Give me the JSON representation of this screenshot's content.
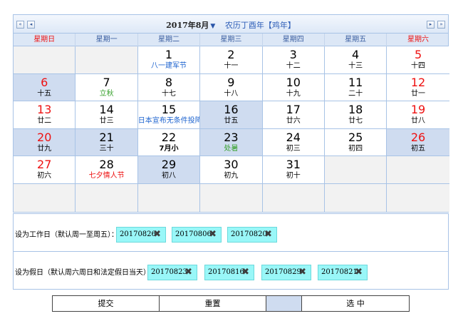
{
  "calendar": {
    "month_title": "2017年8月",
    "caret": "▼",
    "lunar_year": "农历丁酉年【鸡年】",
    "nav": {
      "prev_year": "«",
      "prev_month": "◂",
      "next_month": "▸",
      "next_year": "»"
    },
    "weekdays": [
      "星期日",
      "星期一",
      "星期二",
      "星期三",
      "星期四",
      "星期五",
      "星期六"
    ],
    "days": [
      {
        "num": "",
        "lunar": ""
      },
      {
        "num": "",
        "lunar": ""
      },
      {
        "num": "1",
        "lunar": "八一建军节",
        "cls": "holiday-blue"
      },
      {
        "num": "2",
        "lunar": "十一"
      },
      {
        "num": "3",
        "lunar": "十二"
      },
      {
        "num": "4",
        "lunar": "十三"
      },
      {
        "num": "5",
        "lunar": "十四"
      },
      {
        "num": "6",
        "lunar": "十五",
        "selected": true
      },
      {
        "num": "7",
        "lunar": "立秋",
        "cls": "holiday-green"
      },
      {
        "num": "8",
        "lunar": "十七"
      },
      {
        "num": "9",
        "lunar": "十八"
      },
      {
        "num": "10",
        "lunar": "十九"
      },
      {
        "num": "11",
        "lunar": "二十"
      },
      {
        "num": "12",
        "lunar": "廿一"
      },
      {
        "num": "13",
        "lunar": "廿二"
      },
      {
        "num": "14",
        "lunar": "廿三"
      },
      {
        "num": "15",
        "lunar": "日本宣布无条件投降",
        "cls": "holiday-blue"
      },
      {
        "num": "16",
        "lunar": "廿五",
        "selected": true
      },
      {
        "num": "17",
        "lunar": "廿六"
      },
      {
        "num": "18",
        "lunar": "廿七"
      },
      {
        "num": "19",
        "lunar": "廿八"
      },
      {
        "num": "20",
        "lunar": "廿九",
        "selected": true
      },
      {
        "num": "21",
        "lunar": "三十",
        "selected": true
      },
      {
        "num": "22",
        "lunar": "7月小",
        "cls": "bold"
      },
      {
        "num": "23",
        "lunar": "处暑",
        "cls": "holiday-green",
        "selected": true
      },
      {
        "num": "24",
        "lunar": "初三"
      },
      {
        "num": "25",
        "lunar": "初四"
      },
      {
        "num": "26",
        "lunar": "初五",
        "selected": true
      },
      {
        "num": "27",
        "lunar": "初六"
      },
      {
        "num": "28",
        "lunar": "七夕情人节",
        "cls": "holiday-red"
      },
      {
        "num": "29",
        "lunar": "初八",
        "selected": true
      },
      {
        "num": "30",
        "lunar": "初九"
      },
      {
        "num": "31",
        "lunar": "初十"
      },
      {
        "num": "",
        "lunar": ""
      },
      {
        "num": "",
        "lunar": ""
      },
      {
        "num": "",
        "lunar": ""
      },
      {
        "num": "",
        "lunar": ""
      },
      {
        "num": "",
        "lunar": ""
      },
      {
        "num": "",
        "lunar": ""
      },
      {
        "num": "",
        "lunar": ""
      },
      {
        "num": "",
        "lunar": ""
      },
      {
        "num": "",
        "lunar": ""
      }
    ]
  },
  "settings": {
    "workday_label": "设为工作日（默认周一至周五）：",
    "workday_tags": [
      "20170826",
      "20170806",
      "20170820"
    ],
    "holiday_label": "设为假日（默认周六周日和法定假日当天）：",
    "holiday_tags": [
      "20170823",
      "20170816",
      "20170829",
      "20170821"
    ],
    "remove_glyph": "✖"
  },
  "actions": {
    "submit": "提交",
    "reset": "重置",
    "blank": "",
    "select": "选 中"
  }
}
